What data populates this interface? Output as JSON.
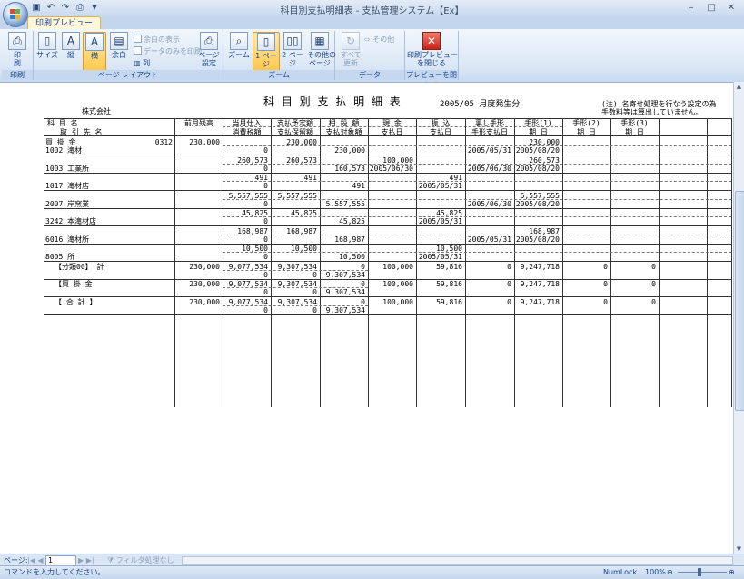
{
  "window": {
    "title": "科目別支払明細表 - 支払管理システム【Ex】"
  },
  "ribbon": {
    "tab": "印刷プレビュー",
    "groups": [
      {
        "label": "印刷",
        "buttons": [
          {
            "label": "印\n刷",
            "icon": "printer-icon"
          }
        ]
      },
      {
        "label": "ページ レイアウト",
        "buttons": [
          {
            "label": "サイズ",
            "icon": "page-size-icon"
          },
          {
            "label": "縦",
            "icon": "portrait-icon"
          },
          {
            "label": "横",
            "icon": "landscape-icon"
          },
          {
            "label": "余白",
            "icon": "margins-icon"
          },
          {
            "label": "ページ\n設定",
            "icon": "page-setup-icon"
          }
        ],
        "small": [
          "余白の表示",
          "データのみを印刷",
          "列"
        ]
      },
      {
        "label": "ズーム",
        "buttons": [
          {
            "label": "ズーム",
            "icon": "zoom-icon"
          },
          {
            "label": "1 ページ",
            "icon": "one-page-icon"
          },
          {
            "label": "2 ページ",
            "icon": "two-page-icon"
          },
          {
            "label": "その他の\nページ",
            "icon": "more-pages-icon"
          }
        ]
      },
      {
        "label": "データ",
        "buttons": [
          {
            "label": "すべて\n更新",
            "icon": "refresh-icon"
          }
        ],
        "small": [
          "その他"
        ]
      },
      {
        "label": "プレビューを閉じる",
        "buttons": [
          {
            "label": "印刷プレビュー\nを閉じる",
            "icon": "close-icon"
          }
        ]
      }
    ]
  },
  "report": {
    "title": "科 目 別 支 払 明 細 表",
    "period": "2005/05 月度発生分",
    "company": "株式会社",
    "note_line1": "(注) 名寄せ処理を行なう設定の為",
    "note_line2": "手数料等は算出していません。",
    "headers": {
      "col1a": "科  目  名",
      "col1b": "取  引  先  名",
      "zenzan": "前月残高",
      "shiire_a": "当月仕入",
      "shiire_b": "消費税額",
      "yotei_a": "支払予定額",
      "yotei_b": "支払保留額",
      "sousai_a": "相  殺  額",
      "sousai_b": "支払対象額",
      "genkin_a": "現    金",
      "genkin_b": "支払日",
      "furikomi_a": "振    込",
      "furikomi_b": "支払日",
      "uragaki_a": "裏し手形",
      "uragaki_b": "手形支払日",
      "tegata1_a": "手形(1)",
      "tegata1_b": "期    日",
      "tegata2_a": "手形(2)",
      "tegata2_b": "期    日",
      "tegata3_a": "手形(3)",
      "tegata3_b": "期    日"
    },
    "rows": [
      {
        "name1": "買    掛    金",
        "code": "0312",
        "name2": "1002     滝材",
        "zenzan": "230,000",
        "shiire": [
          "",
          "0"
        ],
        "yotei": [
          "230,000",
          ""
        ],
        "sousai": [
          "",
          "230,000"
        ],
        "genkin": [
          "",
          ""
        ],
        "furikomi": [
          "",
          ""
        ],
        "uragaki": [
          "",
          "2005/05/31"
        ],
        "tegata1": [
          "230,000",
          "2005/08/20"
        ]
      },
      {
        "name1": "",
        "code": "",
        "name2": "1003        工業所",
        "zenzan": "",
        "shiire": [
          "260,573",
          "0"
        ],
        "yotei": [
          "260,573",
          ""
        ],
        "sousai": [
          "",
          "160,573"
        ],
        "genkin": [
          "100,000",
          "2005/06/30"
        ],
        "furikomi": [
          "",
          ""
        ],
        "uragaki": [
          "",
          "2005/06/30"
        ],
        "tegata1": [
          "260,573",
          "2005/08/20"
        ]
      },
      {
        "name1": "",
        "code": "",
        "name2": "1017       滝材店",
        "zenzan": "",
        "shiire": [
          "491",
          "0"
        ],
        "yotei": [
          "491",
          ""
        ],
        "sousai": [
          "",
          "491"
        ],
        "genkin": [
          "",
          ""
        ],
        "furikomi": [
          "491",
          "2005/05/31"
        ],
        "uragaki": [
          "",
          ""
        ],
        "tegata1": [
          "",
          ""
        ]
      },
      {
        "name1": "",
        "code": "",
        "name2": "2007       岸窯業",
        "zenzan": "",
        "shiire": [
          "5,557,555",
          "0"
        ],
        "yotei": [
          "5,557,555",
          ""
        ],
        "sousai": [
          "",
          "5,557,555"
        ],
        "genkin": [
          "",
          ""
        ],
        "furikomi": [
          "",
          ""
        ],
        "uragaki": [
          "",
          "2005/06/30"
        ],
        "tegata1": [
          "5,557,555",
          "2005/08/20"
        ]
      },
      {
        "name1": "",
        "code": "",
        "name2": "3242    本滝材店",
        "zenzan": "",
        "shiire": [
          "45,825",
          "0"
        ],
        "yotei": [
          "45,825",
          ""
        ],
        "sousai": [
          "",
          "45,825"
        ],
        "genkin": [
          "",
          ""
        ],
        "furikomi": [
          "45,825",
          "2005/05/31"
        ],
        "uragaki": [
          "",
          ""
        ],
        "tegata1": [
          "",
          ""
        ]
      },
      {
        "name1": "",
        "code": "",
        "name2": "6016      滝材所",
        "zenzan": "",
        "shiire": [
          "168,987",
          "0"
        ],
        "yotei": [
          "168,987",
          ""
        ],
        "sousai": [
          "",
          "168,987"
        ],
        "genkin": [
          "",
          ""
        ],
        "furikomi": [
          "",
          ""
        ],
        "uragaki": [
          "",
          "2005/05/31"
        ],
        "tegata1": [
          "168,987",
          "2005/08/20"
        ]
      },
      {
        "name1": "",
        "code": "",
        "name2": "8005 所",
        "zenzan": "",
        "shiire": [
          "10,500",
          "0"
        ],
        "yotei": [
          "10,500",
          ""
        ],
        "sousai": [
          "",
          "10,500"
        ],
        "genkin": [
          "",
          ""
        ],
        "furikomi": [
          "10,500",
          "2005/05/31"
        ],
        "uragaki": [
          "",
          ""
        ],
        "tegata1": [
          "",
          ""
        ]
      }
    ],
    "totals": [
      {
        "label": "【分類00】  計",
        "zenzan": "230,000",
        "shiire": [
          "9,077,534",
          "0"
        ],
        "yotei": [
          "9,307,534",
          "0"
        ],
        "sousai": [
          "0",
          "9,307,534"
        ],
        "genkin": "100,000",
        "furikomi": "59,816",
        "uragaki": "0",
        "tegata1": "9,247,718",
        "tegata2": "0",
        "tegata3": "0"
      },
      {
        "label": "【買    掛    金",
        "zenzan": "230,000",
        "shiire": [
          "9,077,534",
          "0"
        ],
        "yotei": [
          "9,307,534",
          "0"
        ],
        "sousai": [
          "0",
          "9,307,534"
        ],
        "genkin": "100,000",
        "furikomi": "59,816",
        "uragaki": "0",
        "tegata1": "9,247,718",
        "tegata2": "0",
        "tegata3": "0"
      },
      {
        "label": "【    合      計    】",
        "zenzan": "230,000",
        "shiire": [
          "9,077,534",
          "0"
        ],
        "yotei": [
          "9,307,534",
          "0"
        ],
        "sousai": [
          "0",
          "9,307,534"
        ],
        "genkin": "100,000",
        "furikomi": "59,816",
        "uragaki": "0",
        "tegata1": "9,247,718",
        "tegata2": "0",
        "tegata3": "0"
      }
    ]
  },
  "pager": {
    "label": "ページ:",
    "value": "1",
    "filter": "フィルタ処理なし"
  },
  "status": {
    "text": "コマンドを入力してください。",
    "numlock": "NumLock",
    "zoom": "100%"
  }
}
